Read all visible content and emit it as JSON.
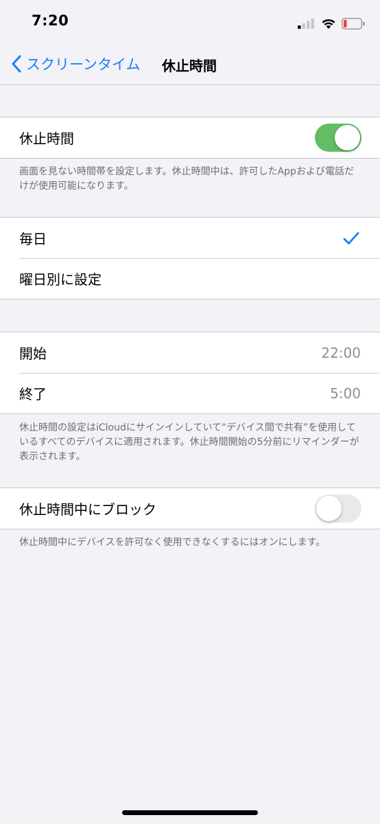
{
  "status_bar": {
    "time": "7:20",
    "icons": [
      "cellular-signal-icon",
      "wifi-icon",
      "battery-low-icon"
    ],
    "battery_color": "#ff3b30"
  },
  "nav": {
    "back_label": "スクリーンタイム",
    "title": "休止時間",
    "accent_color": "#1a7cff"
  },
  "downtime": {
    "label": "休止時間",
    "enabled": true,
    "toggle_on_color": "#62bd64",
    "footnote": "画面を見ない時間帯を設定します。休止時間中は、許可したAppおよび電話だけが使用可能になります。"
  },
  "schedule": {
    "options": [
      {
        "label": "毎日",
        "selected": true
      },
      {
        "label": "曜日別に設定",
        "selected": false
      }
    ]
  },
  "times": {
    "start_label": "開始",
    "start_value": "22:00",
    "end_label": "終了",
    "end_value": "5:00",
    "footnote": "休止時間の設定はiCloudにサインインしていて“デバイス間で共有”を使用しているすべてのデバイスに適用されます。休止時間開始の5分前にリマインダーが表示されます。"
  },
  "block": {
    "label": "休止時間中にブロック",
    "enabled": false,
    "footnote": "休止時間中にデバイスを許可なく使用できなくするにはオンにします。"
  }
}
